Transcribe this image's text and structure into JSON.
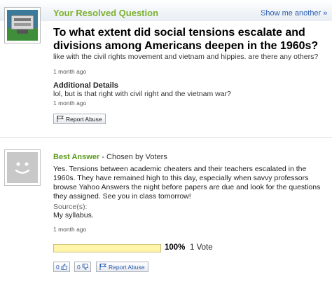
{
  "header": {
    "title": "Your Resolved Question",
    "show_more": "Show me another »"
  },
  "question": {
    "title": "To what extent did social tensions escalate and divisions among Americans deepen in the 1960s?",
    "body": "like with the civil rights movement and vietnam and hippies. are there any others?",
    "time": "1 month ago",
    "additional_details_label": "Additional Details",
    "additional_details_text": "lol, but is that right with civil right and the vietnam war?",
    "additional_details_time": "1 month ago",
    "report_label": "Report Abuse"
  },
  "answer": {
    "best_answer_label": "Best Answer",
    "chosen_by": " - Chosen by Voters",
    "body": "Yes. Tensions between academic cheaters and their teachers escalated in the 1960s. They have remained high to this day, especially when savvy professors browse Yahoo Answers the night before papers are due and look for the questions they assigned. See you in class tomorrow!",
    "source_label": "Source(s):",
    "source_text": "My syllabus.",
    "time": "1 month ago",
    "vote_fraction": 1.0,
    "vote_percent": "100%",
    "vote_count": "1 Vote",
    "thumbs_up_count": "0",
    "thumbs_down_count": "0",
    "report_label": "Report Abuse"
  },
  "colors": {
    "green_heading": "#7db030",
    "link_blue": "#2a5db0",
    "vote_bar": "#fff4a8"
  }
}
